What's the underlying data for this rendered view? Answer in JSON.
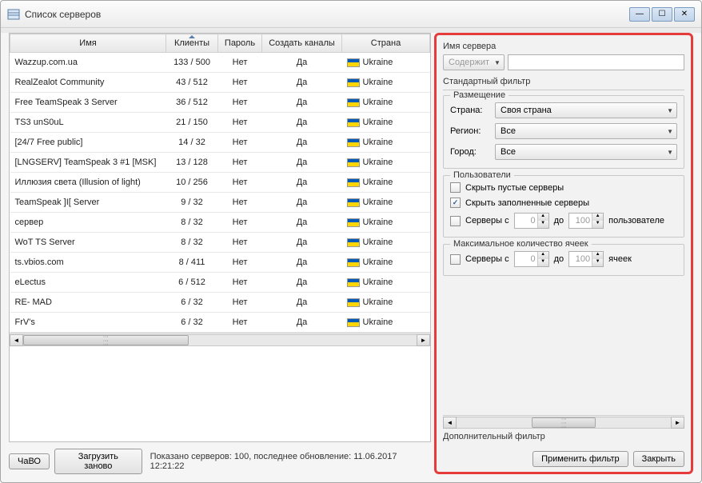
{
  "window": {
    "title": "Список серверов"
  },
  "table": {
    "headers": {
      "name": "Имя",
      "clients": "Клиенты",
      "password": "Пароль",
      "channels": "Создать каналы",
      "country": "Страна"
    },
    "rows": [
      {
        "name": "Wazzup.com.ua",
        "clients": "133 / 500",
        "password": "Нет",
        "channels": "Да",
        "country": "Ukraine"
      },
      {
        "name": "RealZealot Community",
        "clients": "43 / 512",
        "password": "Нет",
        "channels": "Да",
        "country": "Ukraine"
      },
      {
        "name": "Free TeamSpeak 3 Server",
        "clients": "36 / 512",
        "password": "Нет",
        "channels": "Да",
        "country": "Ukraine"
      },
      {
        "name": "TS3 unS0uL",
        "clients": "21 / 150",
        "password": "Нет",
        "channels": "Да",
        "country": "Ukraine"
      },
      {
        "name": "[24/7 Free public]",
        "clients": "14 / 32",
        "password": "Нет",
        "channels": "Да",
        "country": "Ukraine"
      },
      {
        "name": "[LNGSERV] TeamSpeak 3 #1 [MSK]",
        "clients": "13 / 128",
        "password": "Нет",
        "channels": "Да",
        "country": "Ukraine"
      },
      {
        "name": "Иллюзия света (Illusion of light)",
        "clients": "10 / 256",
        "password": "Нет",
        "channels": "Да",
        "country": "Ukraine"
      },
      {
        "name": "TeamSpeak ]I[ Server",
        "clients": "9 / 32",
        "password": "Нет",
        "channels": "Да",
        "country": "Ukraine"
      },
      {
        "name": "сервер",
        "clients": "8 / 32",
        "password": "Нет",
        "channels": "Да",
        "country": "Ukraine"
      },
      {
        "name": "WoT TS Server",
        "clients": "8 / 32",
        "password": "Нет",
        "channels": "Да",
        "country": "Ukraine"
      },
      {
        "name": "ts.vbios.com",
        "clients": "8 / 411",
        "password": "Нет",
        "channels": "Да",
        "country": "Ukraine"
      },
      {
        "name": "eLectus",
        "clients": "6 / 512",
        "password": "Нет",
        "channels": "Да",
        "country": "Ukraine"
      },
      {
        "name": "RE- MAD",
        "clients": "6 / 32",
        "password": "Нет",
        "channels": "Да",
        "country": "Ukraine"
      },
      {
        "name": "FrV's",
        "clients": "6 / 32",
        "password": "Нет",
        "channels": "Да",
        "country": "Ukraine"
      }
    ]
  },
  "footer": {
    "faq": "ЧаВО",
    "reload": "Загрузить заново",
    "status": "Показано серверов: 100, последнее обновление: 11.06.2017 12:21:22",
    "apply": "Применить фильтр",
    "close": "Закрыть"
  },
  "filter": {
    "server_name_label": "Имя сервера",
    "contains": "Содержит",
    "standard_filter": "Стандартный фильтр",
    "location": {
      "label": "Размещение",
      "country_label": "Страна:",
      "country_value": "Своя страна",
      "region_label": "Регион:",
      "region_value": "Все",
      "city_label": "Город:",
      "city_value": "Все"
    },
    "users": {
      "label": "Пользователи",
      "hide_empty": "Скрыть пустые серверы",
      "hide_full": "Скрыть заполненные серверы",
      "servers_with": "Серверы с",
      "to": "до",
      "users_suffix": "пользователе",
      "min": "0",
      "max": "100"
    },
    "slots": {
      "label": "Максимальное количество ячеек",
      "servers_with": "Серверы с",
      "to": "до",
      "slots_suffix": "ячеек",
      "min": "0",
      "max": "100"
    },
    "additional": "Дополнительный фильтр"
  }
}
